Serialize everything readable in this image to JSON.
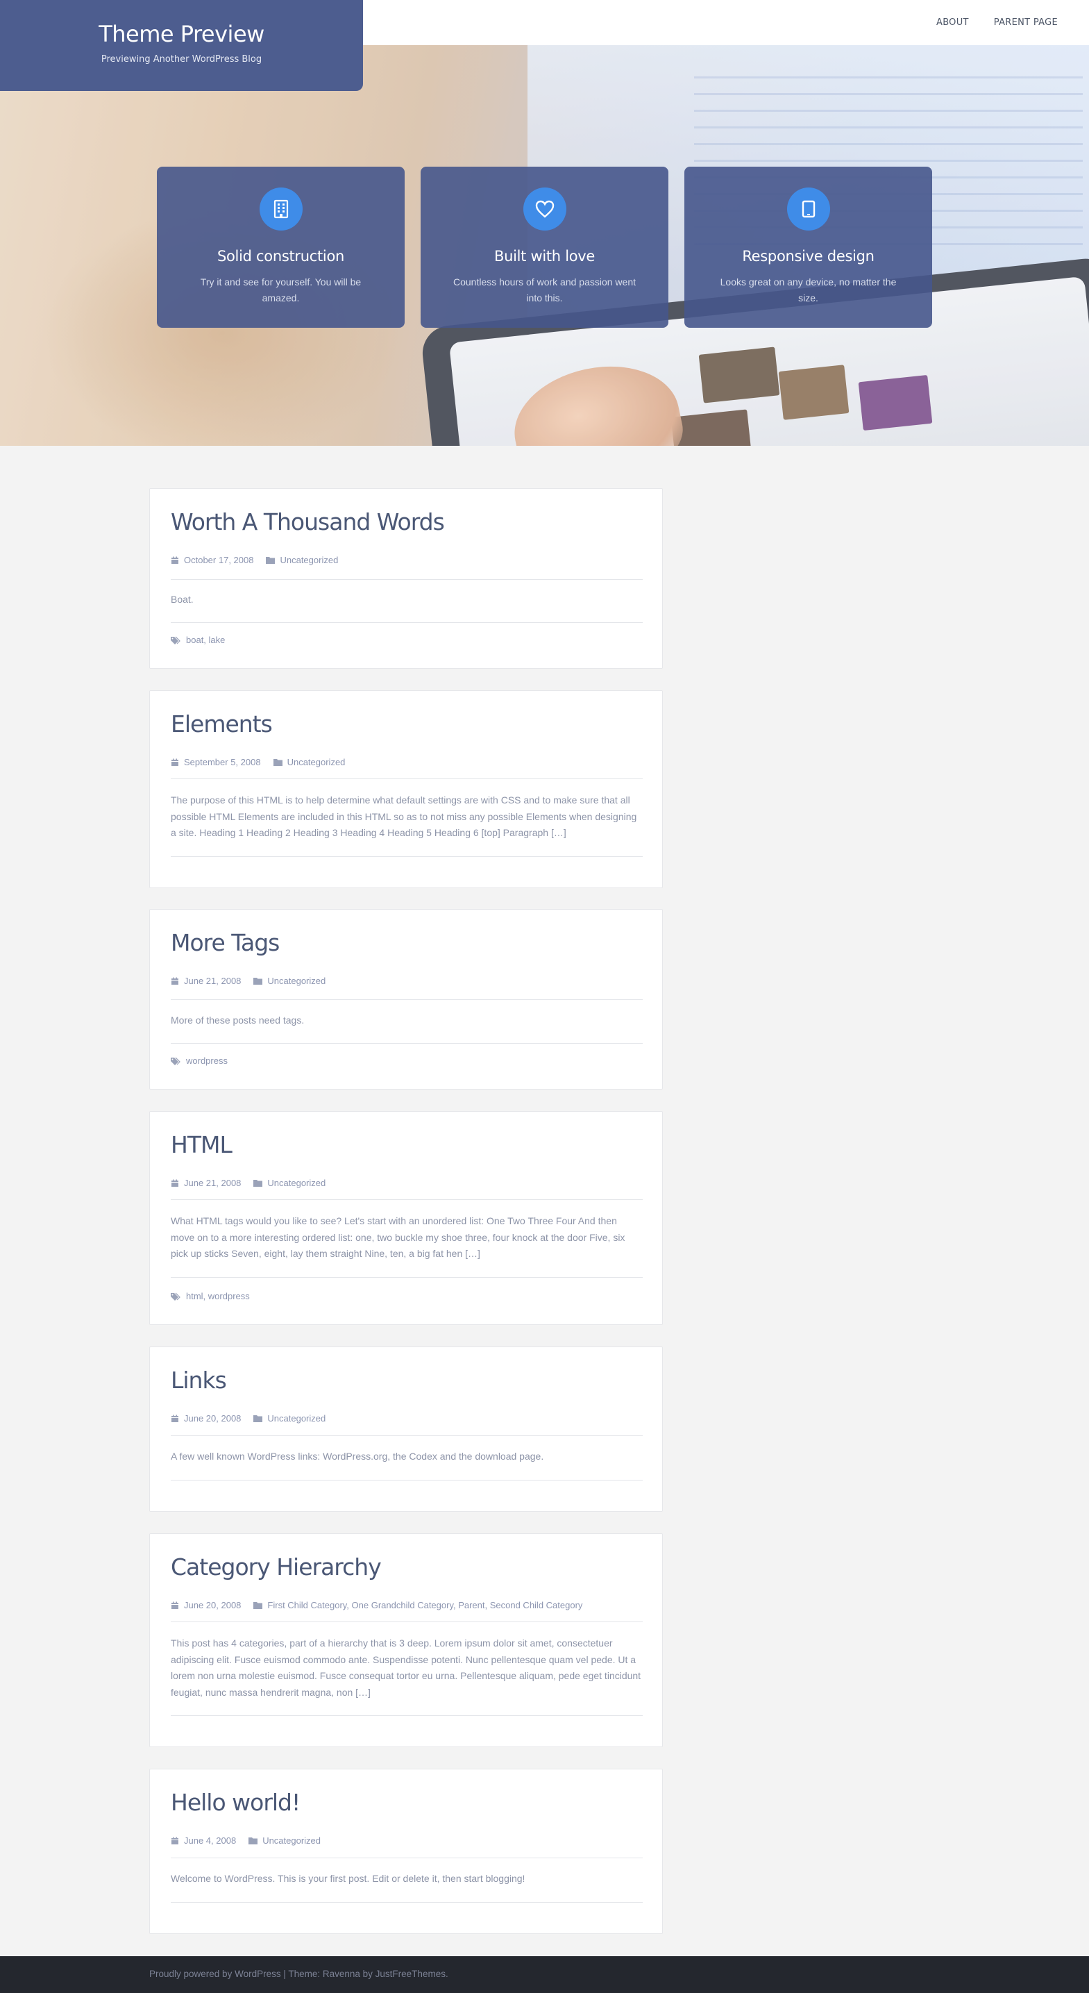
{
  "site": {
    "title": "Theme Preview",
    "tagline": "Previewing Another WordPress Blog"
  },
  "nav": {
    "items": [
      {
        "label": "ABOUT"
      },
      {
        "label": "PARENT PAGE"
      }
    ]
  },
  "features": [
    {
      "icon": "building-icon",
      "title": "Solid construction",
      "text": "Try it and see for yourself. You will be amazed."
    },
    {
      "icon": "heart-icon",
      "title": "Built with love",
      "text": "Countless hours of work and passion went into this."
    },
    {
      "icon": "tablet-icon",
      "title": "Responsive design",
      "text": "Looks great on any device, no matter the size."
    }
  ],
  "posts": [
    {
      "title": "Worth A Thousand Words",
      "date": "October 17, 2008",
      "category": "Uncategorized",
      "excerpt": "Boat.",
      "tags": "boat, lake"
    },
    {
      "title": "Elements",
      "date": "September 5, 2008",
      "category": "Uncategorized",
      "excerpt": "The purpose of this HTML is to help determine what default settings are with CSS and to make sure that all possible HTML Elements are included in this HTML so as to not miss any possible Elements when designing a site. Heading 1 Heading 2 Heading 3 Heading 4 Heading 5 Heading 6 [top] Paragraph […]"
    },
    {
      "title": "More Tags",
      "date": "June 21, 2008",
      "category": "Uncategorized",
      "excerpt": "More of these posts need tags.",
      "tags": "wordpress"
    },
    {
      "title": "HTML",
      "date": "June 21, 2008",
      "category": "Uncategorized",
      "excerpt": "What HTML tags would you like to see? Let's start with an unordered list: One Two Three Four And then move on to a more interesting ordered list: one, two buckle my shoe three, four knock at the door Five, six pick up sticks Seven, eight, lay them straight Nine, ten, a big fat hen […]",
      "tags": "html, wordpress"
    },
    {
      "title": "Links",
      "date": "June 20, 2008",
      "category": "Uncategorized",
      "excerpt": "A few well known WordPress links: WordPress.org, the Codex and the download page."
    },
    {
      "title": "Category Hierarchy",
      "date": "June 20, 2008",
      "category": "First Child Category, One Grandchild Category, Parent, Second Child Category",
      "excerpt": "This post has 4 categories, part of a hierarchy that is 3 deep. Lorem ipsum dolor sit amet, consectetuer adipiscing elit. Fusce euismod commodo ante. Suspendisse potenti. Nunc pellentesque quam vel pede. Ut a lorem non urna molestie euismod. Fusce consequat tortor eu urna. Pellentesque aliquam, pede eget tincidunt feugiat, nunc massa hendrerit magna, non […]"
    },
    {
      "title": "Hello world!",
      "date": "June 4, 2008",
      "category": "Uncategorized",
      "excerpt": "Welcome to WordPress. This is your first post. Edit or delete it, then start blogging!"
    }
  ],
  "footer": {
    "text": "Proudly powered by WordPress | Theme: Ravenna by JustFreeThemes."
  },
  "colors": {
    "brand": "#4d5d8f",
    "accent": "#3f8ce8",
    "footer": "#24272e"
  }
}
